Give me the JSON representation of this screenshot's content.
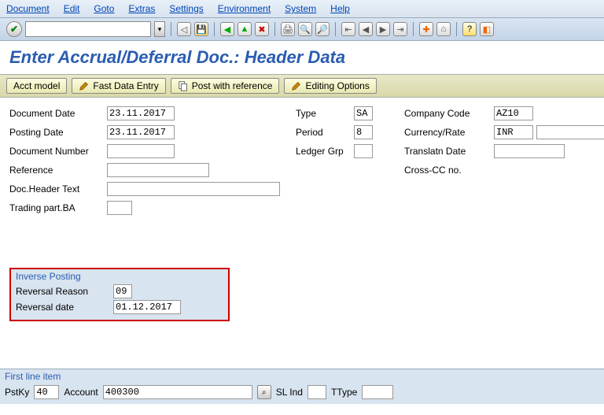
{
  "menu": [
    "Document",
    "Edit",
    "Goto",
    "Extras",
    "Settings",
    "Environment",
    "System",
    "Help"
  ],
  "title": "Enter Accrual/Deferral Doc.: Header Data",
  "buttons": {
    "acct_model": "Acct model",
    "fast_entry": "Fast Data Entry",
    "post_ref": "Post with reference",
    "editing": "Editing Options"
  },
  "left": {
    "doc_date_lbl": "Document Date",
    "doc_date": "23.11.2017",
    "post_date_lbl": "Posting Date",
    "post_date": "23.11.2017",
    "doc_num_lbl": "Document Number",
    "doc_num": "",
    "ref_lbl": "Reference",
    "ref": "",
    "header_lbl": "Doc.Header Text",
    "header": "",
    "trading_lbl": "Trading part.BA",
    "trading": ""
  },
  "mid": {
    "type_lbl": "Type",
    "type": "SA",
    "period_lbl": "Period",
    "period": "8",
    "ledger_lbl": "Ledger Grp",
    "ledger": ""
  },
  "right": {
    "cc_lbl": "Company Code",
    "cc": "AZ10",
    "curr_lbl": "Currency/Rate",
    "curr": "INR",
    "rate": "",
    "transl_lbl": "Translatn Date",
    "transl": "",
    "cross_lbl": "Cross-CC no.",
    "cross": ""
  },
  "inverse": {
    "title": "Inverse Posting",
    "reason_lbl": "Reversal Reason",
    "reason": "09",
    "date_lbl": "Reversal date",
    "date": "01.12.2017"
  },
  "footer": {
    "title": "First line item",
    "pstky_lbl": "PstKy",
    "pstky": "40",
    "account_lbl": "Account",
    "account": "400300",
    "slind_lbl": "SL Ind",
    "slind": "",
    "ttype_lbl": "TType",
    "ttype": ""
  }
}
